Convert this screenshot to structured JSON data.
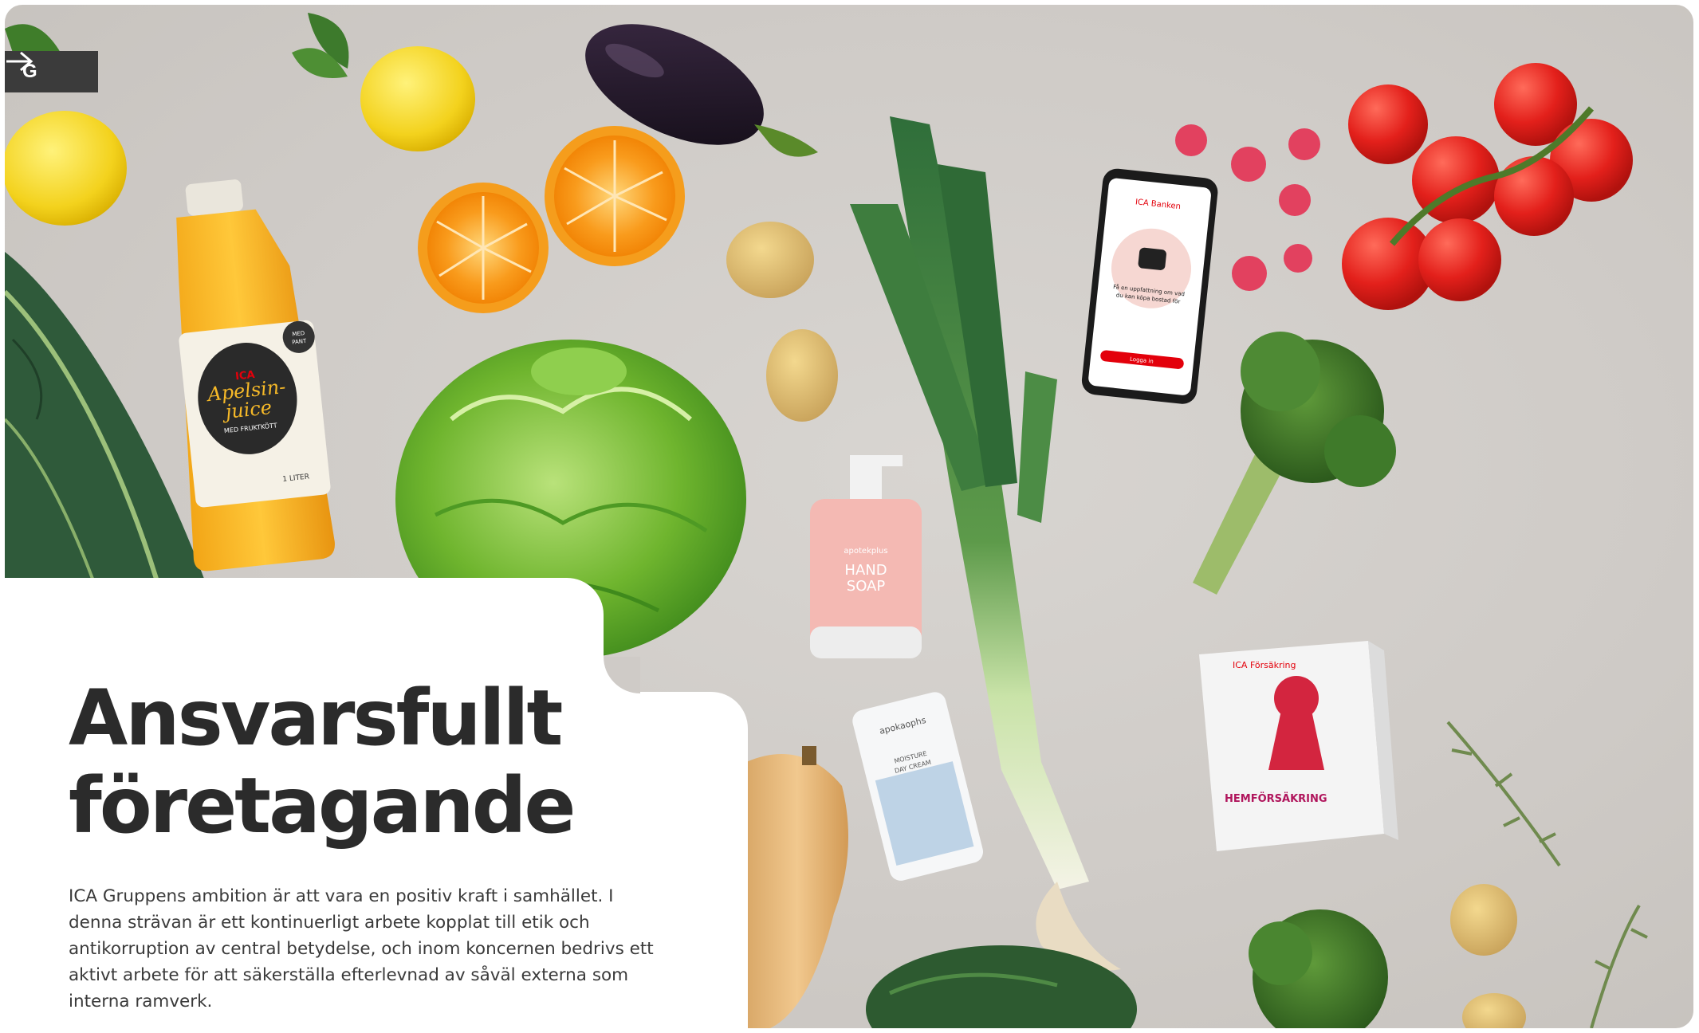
{
  "nav": {
    "back_icon": "arrow-right-icon",
    "label": "G"
  },
  "hero": {
    "products": {
      "juice_brand": "ICA",
      "juice_name_line1": "Apelsin-",
      "juice_name_line2": "juice",
      "juice_sub": "MED FRUKTKÖTT",
      "juice_volume": "1 LITER",
      "juice_badge_line1": "MED",
      "juice_badge_line2": "PANT",
      "soap_line1": "HAND",
      "soap_line2": "SOAP",
      "soap_brand": "apotekplus",
      "cream_brand": "apokaophs",
      "cream_line1": "MOISTURE",
      "cream_line2": "DAY CREAM",
      "phone_header": "ICA Banken",
      "phone_text_line1": "Få en uppfattning om vad",
      "phone_text_line2": "du kan köpa bostad för",
      "phone_button": "Logga in",
      "box_brand": "ICA Försäkring",
      "box_title": "HEMFÖRSÄKRING"
    }
  },
  "content": {
    "title_line1": "Ansvarsfullt",
    "title_line2": "företagande",
    "body": "ICA Gruppens ambition är att vara en positiv kraft i samhället. I denna strävan är ett kontinuerligt arbete kopplat till etik och antikorruption av central betydelse, och inom koncernen bedrivs ett aktivt arbete för att säkerställa efterlevnad av såväl externa som interna ramverk."
  },
  "colors": {
    "background": "#cfcbc7",
    "nav_bg": "#3b3b3b",
    "title": "#2b2b2b",
    "text": "#3a3a3a",
    "accent_red": "#e3000b"
  }
}
